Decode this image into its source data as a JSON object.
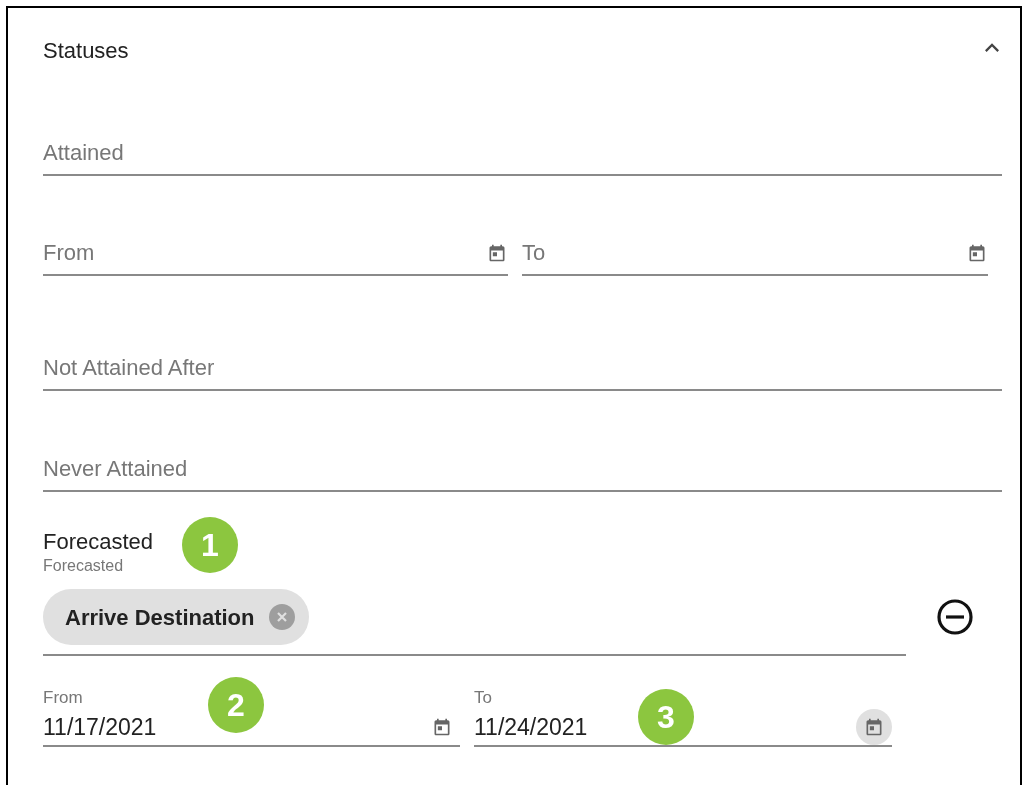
{
  "section": {
    "title": "Statuses",
    "expanded": true
  },
  "fields": [
    {
      "kind": "text",
      "placeholder": "Attained"
    },
    {
      "kind": "date_range",
      "from": {
        "placeholder": "From"
      },
      "to": {
        "placeholder": "To"
      }
    },
    {
      "kind": "text",
      "placeholder": "Not Attained After"
    },
    {
      "kind": "text",
      "placeholder": "Never Attained"
    }
  ],
  "forecasted": {
    "label": "Forecasted",
    "field_label": "Forecasted",
    "chips": [
      "Arrive Destination"
    ],
    "from": {
      "label": "From",
      "value": "11/17/2021",
      "icon_hovered": false
    },
    "to": {
      "label": "To",
      "value": "11/24/2021",
      "icon_hovered": true
    }
  },
  "badges": [
    {
      "text": "1"
    },
    {
      "text": "2"
    },
    {
      "text": "3"
    }
  ]
}
